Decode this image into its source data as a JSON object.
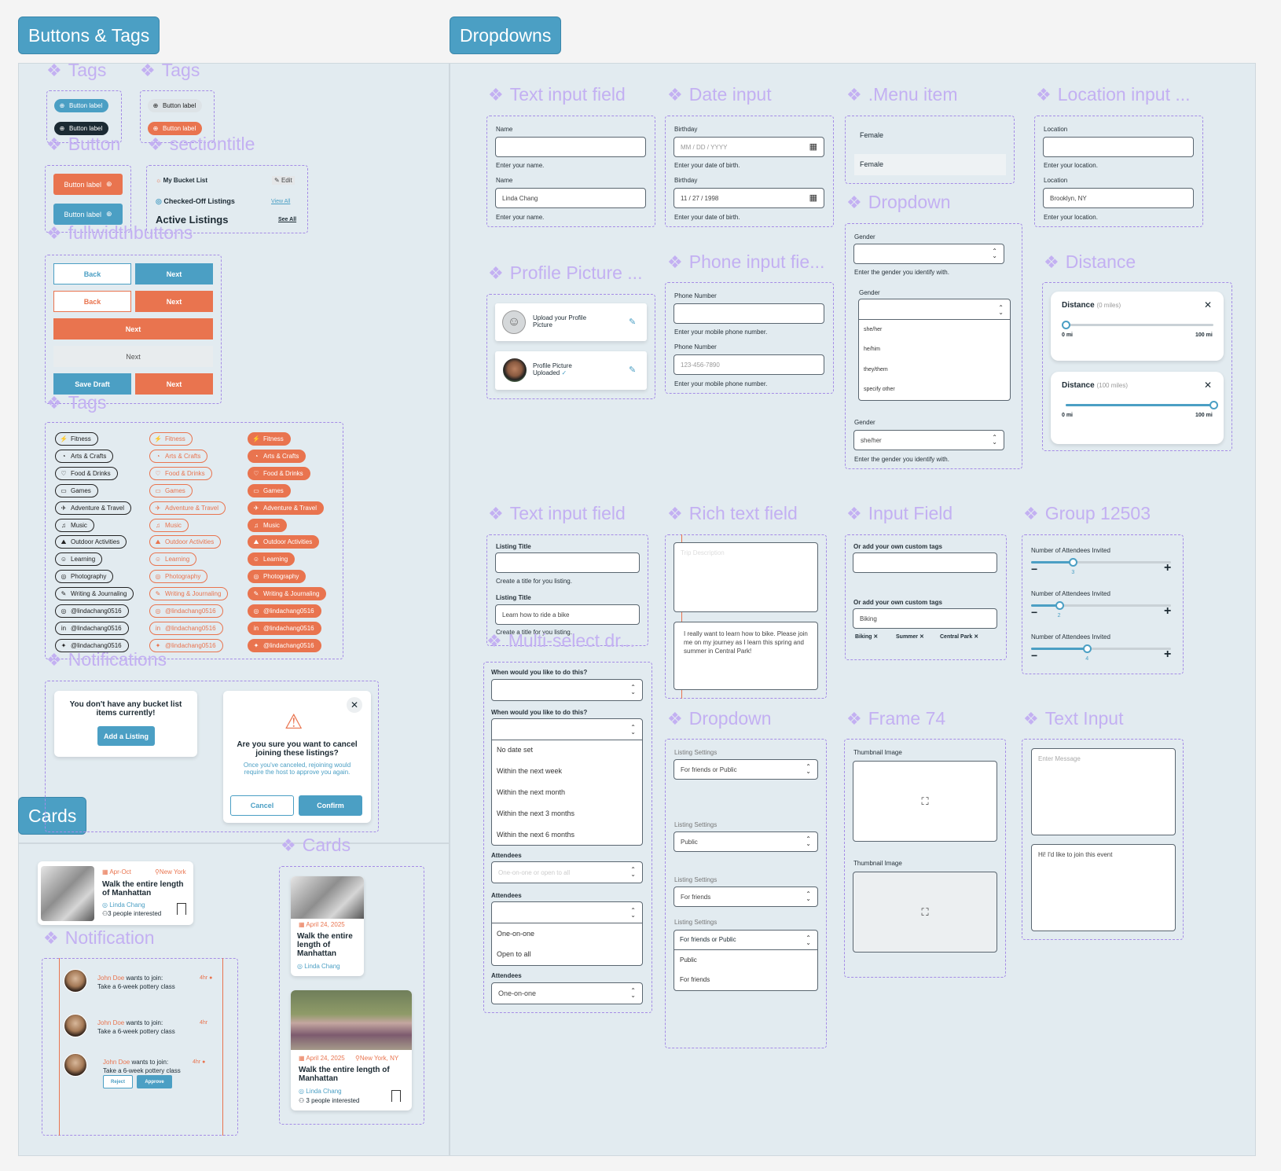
{
  "sections": {
    "buttons_tags": "Buttons & Tags",
    "dropdowns": "Dropdowns",
    "cards": "Cards"
  },
  "component_titles": {
    "tags_a": "Tags",
    "tags_b": "Tags",
    "button": "Button",
    "sectiontitle": "sectiontitle",
    "fullwidthbuttons": "fullwidthbuttons",
    "tags_list": "Tags",
    "notifications": "Notifications",
    "cards": "Cards",
    "notification": "Notification",
    "text_input_field": "Text input field",
    "date_input": "Date input",
    "menu_item": ".Menu item",
    "location_input": "Location input ...",
    "dropdown_a": "Dropdown",
    "profile_picture": "Profile Picture ...",
    "phone_input": "Phone input fie...",
    "distance": "Distance",
    "text_input_field_2": "Text input field",
    "rich_text_field": "Rich text field",
    "input_field": "Input Field",
    "group": "Group 12503",
    "multi_select": "Multi-select dr...",
    "dropdown_b": "Dropdown",
    "frame74": "Frame 74",
    "text_input": "Text Input"
  },
  "tag_buttons": {
    "label": "Button label"
  },
  "buttons": {
    "label": "Button label"
  },
  "sectiontitle": {
    "bucket": "My Bucket List",
    "edit": "Edit",
    "checked": "Checked-Off Listings",
    "view_all": "View All",
    "active": "Active Listings",
    "see_all": "See All"
  },
  "fullwidth": {
    "back": "Back",
    "next": "Next",
    "save_draft": "Save Draft"
  },
  "tags": [
    "Fitness",
    "Arts & Crafts",
    "Food & Drinks",
    "Games",
    "Adventure & Travel",
    "Music",
    "Outdoor Activities",
    "Learning",
    "Photography",
    "Writing & Journaling",
    "@lindachang0516",
    "@lindachang0516",
    "@lindachang0516"
  ],
  "tag_icons": [
    "⚡",
    "◔",
    "♡",
    "▭",
    "✈",
    "♫",
    "⛰",
    "☺",
    "◎",
    "✎",
    "◎",
    "in",
    "✦"
  ],
  "notifications": {
    "empty_msg": "You don't have any bucket list items currently!",
    "add_listing": "Add a Listing",
    "cancel_title": "Are you sure you want to cancel joining these listings?",
    "cancel_body": "Once you've canceled, rejoining would require the host to approve you again.",
    "cancel": "Cancel",
    "confirm": "Confirm"
  },
  "cards": {
    "c1": {
      "date": "Apr-Oct",
      "loc": "New York",
      "title": "Walk the entire length of Manhattan",
      "host": "Linda Chang",
      "interest": "3 people interested"
    },
    "c2": {
      "date": "April 24, 2025",
      "title": "Walk the entire length of Manhattan",
      "host": "Linda Chang"
    },
    "c3": {
      "date": "April 24, 2025",
      "loc": "New York, NY",
      "title": "Walk the entire length of Manhattan",
      "host": "Linda Chang",
      "interest": "3 people interested"
    }
  },
  "notif_list": {
    "name": "John Doe",
    "action": "wants to join:",
    "event": "Take a 6-week pottery class",
    "time": "4hr",
    "reject": "Reject",
    "approve": "Approve"
  },
  "text_input": {
    "label": "Name",
    "help": "Enter your name.",
    "value": "Linda Chang"
  },
  "date_input": {
    "label": "Birthday",
    "placeholder": "MM / DD / YYYY",
    "help": "Enter your date of birth.",
    "value": "11 / 27 / 1998"
  },
  "menu_item": {
    "label": "Female"
  },
  "location_input": {
    "label": "Location",
    "help": "Enter your location.",
    "value": "Brooklyn, NY"
  },
  "gender": {
    "label": "Gender",
    "help": "Enter the gender you identify with.",
    "options": [
      "she/her",
      "he/him",
      "they/them",
      "specify other"
    ],
    "value": "she/her"
  },
  "profile": {
    "upload": "Upload your Profile Picture",
    "uploaded": "Profile Picture Uploaded"
  },
  "phone": {
    "label": "Phone Number",
    "help": "Enter your mobile phone number.",
    "placeholder": "123-456-7890"
  },
  "distance": {
    "label": "Distance",
    "sub0": "(0 miles)",
    "sub100": "(100 miles)",
    "min": "0 mi",
    "max": "100 mi",
    "values": [
      0,
      100
    ]
  },
  "listing": {
    "label": "Listing Title",
    "help": "Create a title for you listing.",
    "value": "Learn how to ride a bike"
  },
  "rich": {
    "placeholder": "Trip Description",
    "value": "I really want to learn how to bike. Please join me on my journey as I learn this spring and summer in Central Park!"
  },
  "custom_tags": {
    "label": "Or add your own custom tags",
    "value": "Biking",
    "chips": [
      "Biking",
      "Summer",
      "Central Park"
    ]
  },
  "attendees_slider": {
    "label": "Number of Attendees Invited",
    "values": [
      3,
      2,
      4
    ],
    "max": 10
  },
  "when": {
    "label": "When would you like to do this?",
    "options": [
      "No date set",
      "Within the next week",
      "Within the next month",
      "Within the next 3 months",
      "Within the next 6 months"
    ]
  },
  "attendees": {
    "label": "Attendees",
    "placeholder": "One-on-one or open to all",
    "options": [
      "One-on-one",
      "Open to all"
    ],
    "value": "One-on-one"
  },
  "listing_settings": {
    "label": "Listing Settings",
    "values": [
      "For friends or Public",
      "Public",
      "For friends",
      "For friends or Public"
    ],
    "options": [
      "Public",
      "For friends"
    ]
  },
  "thumbnail": {
    "label": "Thumbnail Image"
  },
  "message": {
    "placeholder": "Enter Message",
    "value": "Hi! I'd like to join this event"
  },
  "colors": {
    "primary": "#4b9fc4",
    "accent": "#e9744f",
    "panel": "#e2ebf0",
    "component_title": "#c3b0f2"
  }
}
